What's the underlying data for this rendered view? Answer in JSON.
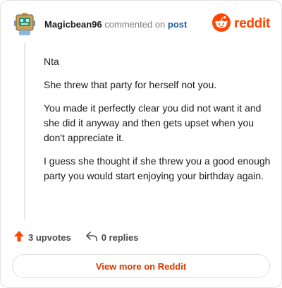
{
  "header": {
    "username": "Magicbean96",
    "action": "commented on",
    "post_link": "post",
    "logo_text": "reddit",
    "avatar_icon": "robot-avatar-icon",
    "logo_icon": "reddit-snoo-icon"
  },
  "comment": {
    "paragraphs": [
      "Nta",
      "She threw that party for herself not you.",
      "You made it perfectly clear you did not want it and she did it anyway and then gets upset when you don't appreciate it.",
      "I guess she thought if she threw you a good enough party you would start enjoying your birthday again."
    ]
  },
  "footer": {
    "upvotes": "3 upvotes",
    "replies": "0 replies",
    "upvote_icon": "upvote-arrow-icon",
    "reply_icon": "reply-arrow-icon"
  },
  "cta": {
    "label": "View more on Reddit"
  },
  "colors": {
    "brand": "#ff4500",
    "link": "#1d5f9e",
    "cta_text": "#d93a00"
  }
}
